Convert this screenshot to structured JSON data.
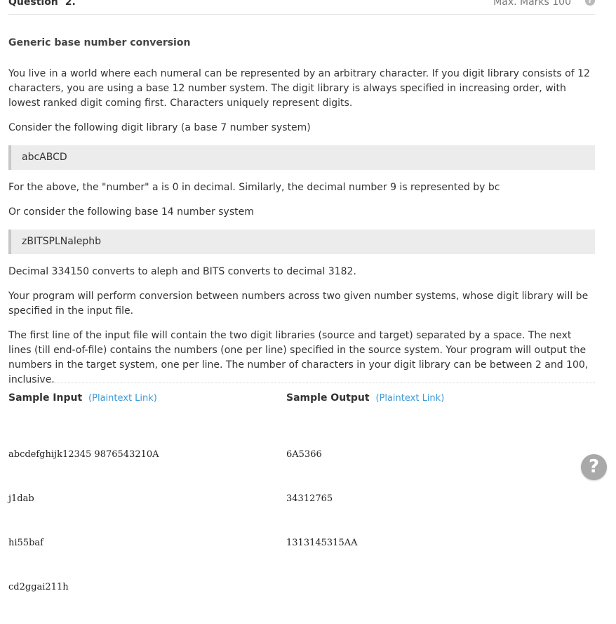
{
  "question": {
    "label": "Question",
    "number": "2.",
    "max_marks": "Max. Marks 100",
    "help_icon": "question-circle-icon"
  },
  "problem": {
    "title": "Generic base number conversion",
    "p1": "You live in a world where each numeral can be represented by an arbitrary character. If you digit library consists of 12 characters, you are using a base 12 number system. The digit library is always specified in increasing order, with lowest ranked digit coming first. Characters uniquely represent digits.",
    "p2": "Consider the following digit library (a base 7 number system)",
    "code1": "abcABCD",
    "p3": "For the above, the \"number\" a is 0 in decimal. Similarly, the decimal number 9 is represented by bc",
    "p4": "Or consider the following base 14 number system",
    "code2": "zBITSPLNalephb",
    "p5": "Decimal 334150 converts to aleph and BITS converts to decimal 3182.",
    "p6": "Your program will perform conversion between numbers across two given number systems, whose digit library will be specified in the input file.",
    "p7": "The first line of the input file will contain the two digit libraries (source and target) separated by a space. The next lines (till end-of-file) contains the numbers (one per line) specified in the source system. Your program will output the numbers in the target system, one per line. The number of characters in your digit library can be between 2 and 100, inclusive."
  },
  "samples": {
    "input_label": "Sample Input",
    "input_link": "(Plaintext Link)",
    "input_lines": [
      "abcdefghijk12345 9876543210A",
      "j1dab",
      "hi55baf",
      "cd2ggai211h"
    ],
    "output_label": "Sample Output",
    "output_link": "(Plaintext Link)",
    "output_lines": [
      "6A5366",
      "34312765",
      "1313145315AA"
    ]
  },
  "floating_help": "?"
}
